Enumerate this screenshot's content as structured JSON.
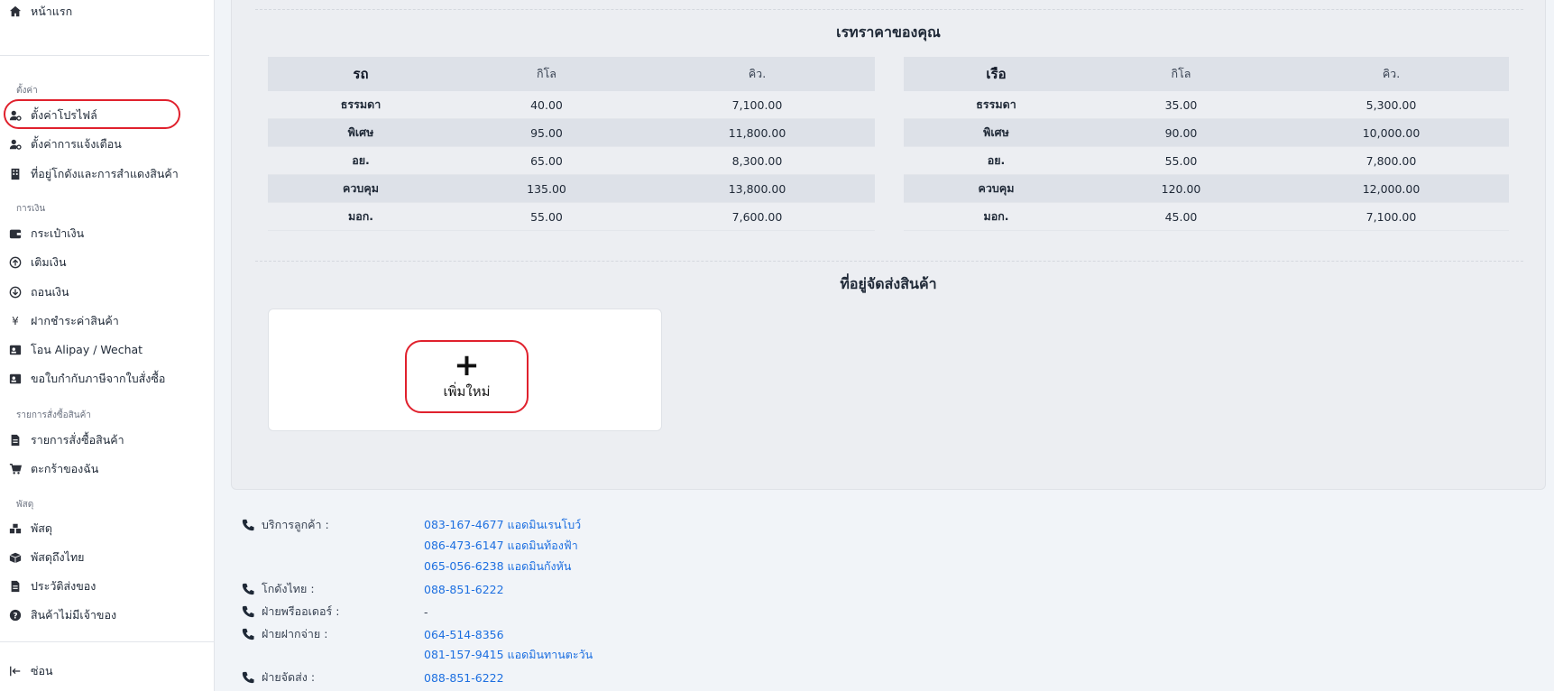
{
  "sidebar": {
    "home": "หน้าแรก",
    "sections": {
      "settings": "ตั้งค่า",
      "finance": "การเงิน",
      "orders": "รายการสั่งซื้อสินค้า",
      "parcels": "พัสดุ"
    },
    "items": {
      "profile": "ตั้งค่าโปรไฟล์",
      "notify": "ตั้งค่าการแจ้งเตือน",
      "warehouse": "ที่อยู่โกดังและการสำแดงสินค้า",
      "wallet": "กระเป๋าเงิน",
      "topup": "เติมเงิน",
      "withdraw": "ถอนเงิน",
      "payment": "ฝากชำระค่าสินค้า",
      "alipay": "โอน Alipay / Wechat",
      "tax": "ขอใบกำกับภาษีจากใบสั่งซื้อ",
      "orderlist": "รายการสั่งซื้อสินค้า",
      "cart": "ตะกร้าของฉัน",
      "parcel": "พัสดุ",
      "parcel_th": "พัสดุถึงไทย",
      "history": "ประวัติส่งของ",
      "ownerless": "สินค้าไม่มีเจ้าของ",
      "hide": "ซ่อน"
    }
  },
  "rates": {
    "title": "เรทราคาของคุณ",
    "car": {
      "header": [
        "รถ",
        "กิโล",
        "คิว."
      ],
      "rows": [
        [
          "ธรรมดา",
          "40.00",
          "7,100.00"
        ],
        [
          "พิเศษ",
          "95.00",
          "11,800.00"
        ],
        [
          "อย.",
          "65.00",
          "8,300.00"
        ],
        [
          "ควบคุม",
          "135.00",
          "13,800.00"
        ],
        [
          "มอก.",
          "55.00",
          "7,600.00"
        ]
      ]
    },
    "ship": {
      "header": [
        "เรือ",
        "กิโล",
        "คิว."
      ],
      "rows": [
        [
          "ธรรมดา",
          "35.00",
          "5,300.00"
        ],
        [
          "พิเศษ",
          "90.00",
          "10,000.00"
        ],
        [
          "อย.",
          "55.00",
          "7,800.00"
        ],
        [
          "ควบคุม",
          "120.00",
          "12,000.00"
        ],
        [
          "มอก.",
          "45.00",
          "7,100.00"
        ]
      ]
    }
  },
  "address": {
    "title": "ที่อยู่จัดส่งสินค้า",
    "add_label": "เพิ่มใหม่"
  },
  "contacts": {
    "service_label": "บริการลูกค้า :",
    "service_1": "083-167-4677 แอดมินเรนโบว์",
    "service_2": "086-473-6147 แอดมินท้องฟ้า",
    "service_3": "065-056-6238 แอดมินกังหัน",
    "warehouse_label": "โกดังไทย :",
    "warehouse_1": "088-851-6222",
    "preorder_label": "ฝ่ายพรีออเดอร์ :",
    "preorder_1": "-",
    "payment_label": "ฝ่ายฝากจ่าย :",
    "payment_1": "064-514-8356",
    "payment_2": "081-157-9415 แอดมินทานตะวัน",
    "shipping_label": "ฝ่ายจัดส่ง :",
    "shipping_1": "088-851-6222"
  },
  "colors": {
    "accent_link": "#1d6fe0",
    "highlight": "#e0212d",
    "table_shade": "#dde1e8"
  }
}
